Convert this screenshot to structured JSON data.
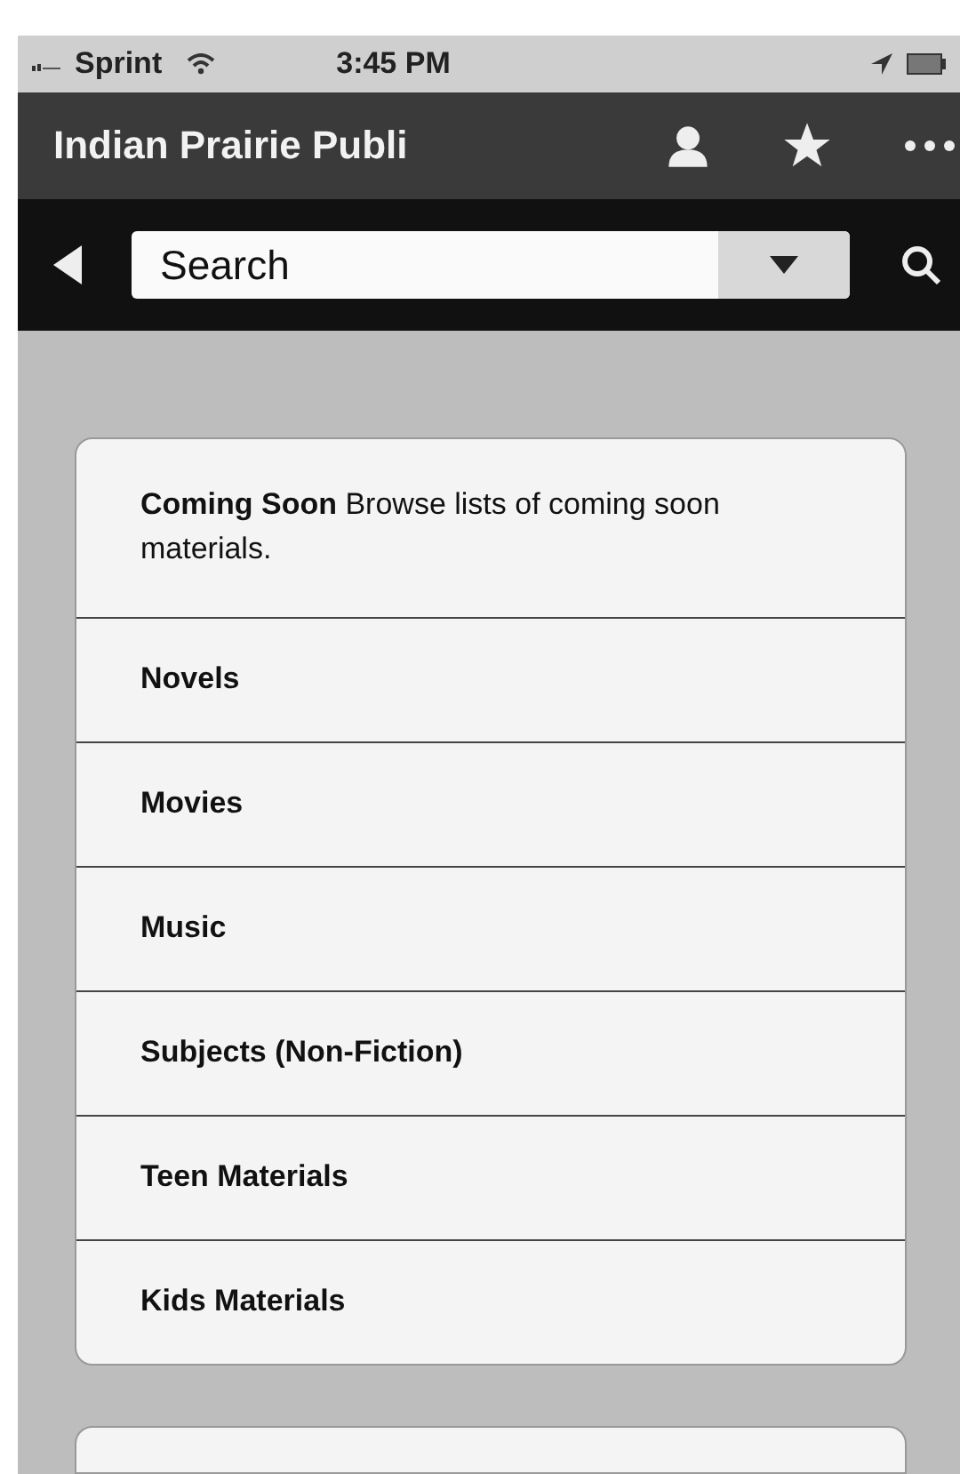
{
  "status_bar": {
    "carrier": "Sprint",
    "time": "3:45 PM"
  },
  "header": {
    "title": "Indian Prairie Publi"
  },
  "search": {
    "value": "Search"
  },
  "menu": [
    {
      "title": "Coming Soon",
      "description": "Browse lists of coming soon materials."
    },
    {
      "title": "Novels"
    },
    {
      "title": "Movies"
    },
    {
      "title": "Music"
    },
    {
      "title": "Subjects (Non-Fiction)"
    },
    {
      "title": "Teen Materials"
    },
    {
      "title": "Kids Materials"
    }
  ]
}
